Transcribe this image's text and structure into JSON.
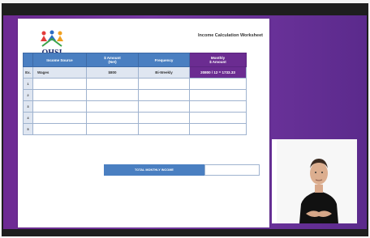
{
  "slide": {
    "logo_text": "OHSI",
    "title": "Income Calculation Worksheet"
  },
  "table": {
    "headers": [
      "",
      "Income Source",
      "$ Amount\n(Net)",
      "Frequency",
      "Monthly\n$ Amount"
    ],
    "example": {
      "label": "Ex.",
      "source": "Wages",
      "amount": "$800",
      "frequency": "Bi-Weekly",
      "monthly": "20800 / 12 = 1733.33"
    },
    "rows": [
      "1",
      "2",
      "3",
      "4",
      "5"
    ]
  },
  "total_label": "TOTAL MONTHLY INCOME",
  "colors": {
    "header_blue": "#4a7fc1",
    "highlight_purple": "#6b2c91",
    "background_purple": "#6d2a93"
  }
}
